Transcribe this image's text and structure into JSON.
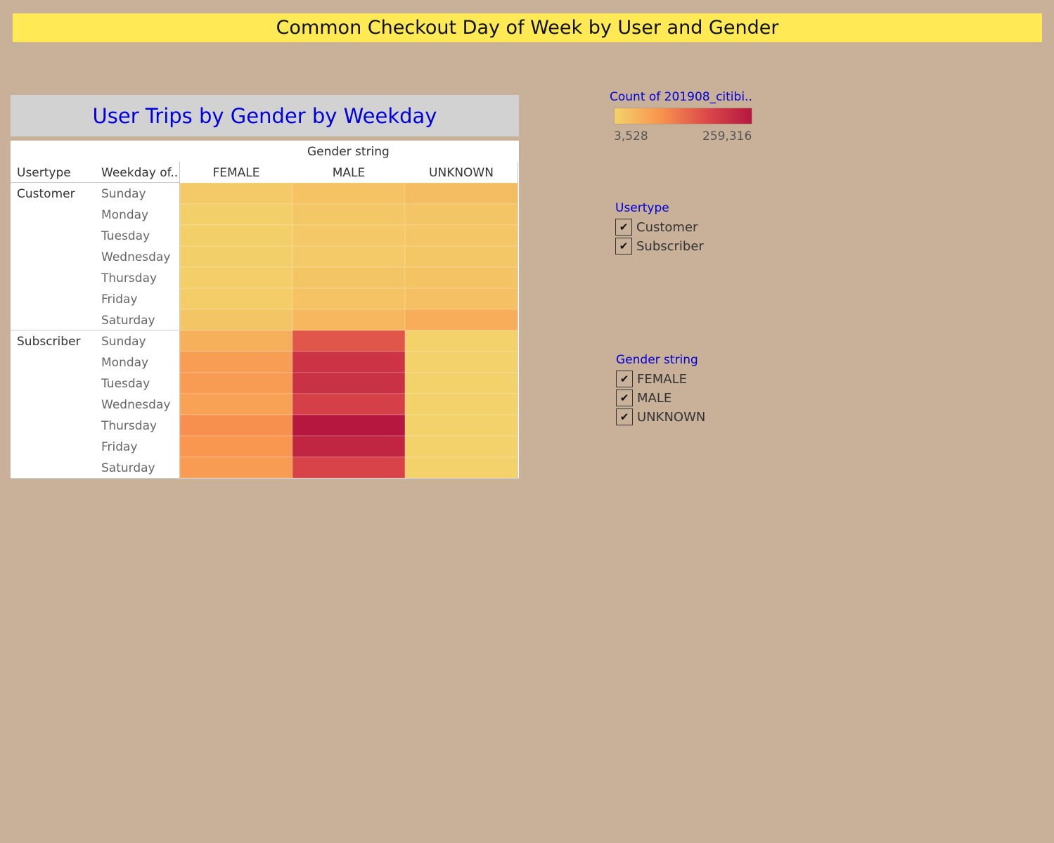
{
  "dashboard_title": "Common Checkout Day of Week by User and Gender",
  "sheet_title": "User Trips by Gender by Weekday",
  "headers": {
    "column_group": "Gender string",
    "usertype": "Usertype",
    "weekday": "Weekday of.."
  },
  "legend": {
    "color_title": "Count of 201908_citibi..",
    "min_label": "3,528",
    "max_label": "259,316",
    "min": 3528,
    "max": 259316,
    "ramp_colors": [
      "#f3d26b",
      "#f9944f",
      "#dc4a4a",
      "#b5173f"
    ]
  },
  "filters": {
    "usertype": {
      "title": "Usertype",
      "items": [
        {
          "label": "Customer",
          "checked": true
        },
        {
          "label": "Subscriber",
          "checked": true
        }
      ]
    },
    "gender": {
      "title": "Gender string",
      "items": [
        {
          "label": "FEMALE",
          "checked": true
        },
        {
          "label": "MALE",
          "checked": true
        },
        {
          "label": "UNKNOWN",
          "checked": true
        }
      ]
    }
  },
  "check_glyph": "✔",
  "chart_data": {
    "type": "heatmap",
    "title": "User Trips by Gender by Weekday",
    "columns": [
      "FEMALE",
      "MALE",
      "UNKNOWN"
    ],
    "groups": [
      "Customer",
      "Subscriber"
    ],
    "days": [
      "Sunday",
      "Monday",
      "Tuesday",
      "Wednesday",
      "Thursday",
      "Friday",
      "Saturday"
    ],
    "values": {
      "Customer": [
        [
          14000,
          26000,
          33000
        ],
        [
          8000,
          18000,
          21000
        ],
        [
          7500,
          17000,
          20000
        ],
        [
          7000,
          16500,
          19000
        ],
        [
          9000,
          21000,
          24000
        ],
        [
          11000,
          25000,
          29000
        ],
        [
          22000,
          40000,
          55000
        ]
      ],
      "Subscriber": [
        [
          50000,
          160000,
          3528
        ],
        [
          75000,
          210000,
          3600
        ],
        [
          78000,
          215000,
          3600
        ],
        [
          70000,
          190000,
          3600
        ],
        [
          95000,
          259316,
          3700
        ],
        [
          85000,
          235000,
          3700
        ],
        [
          78000,
          185000,
          3600
        ]
      ]
    },
    "color_min": 3528,
    "color_max": 259316
  }
}
